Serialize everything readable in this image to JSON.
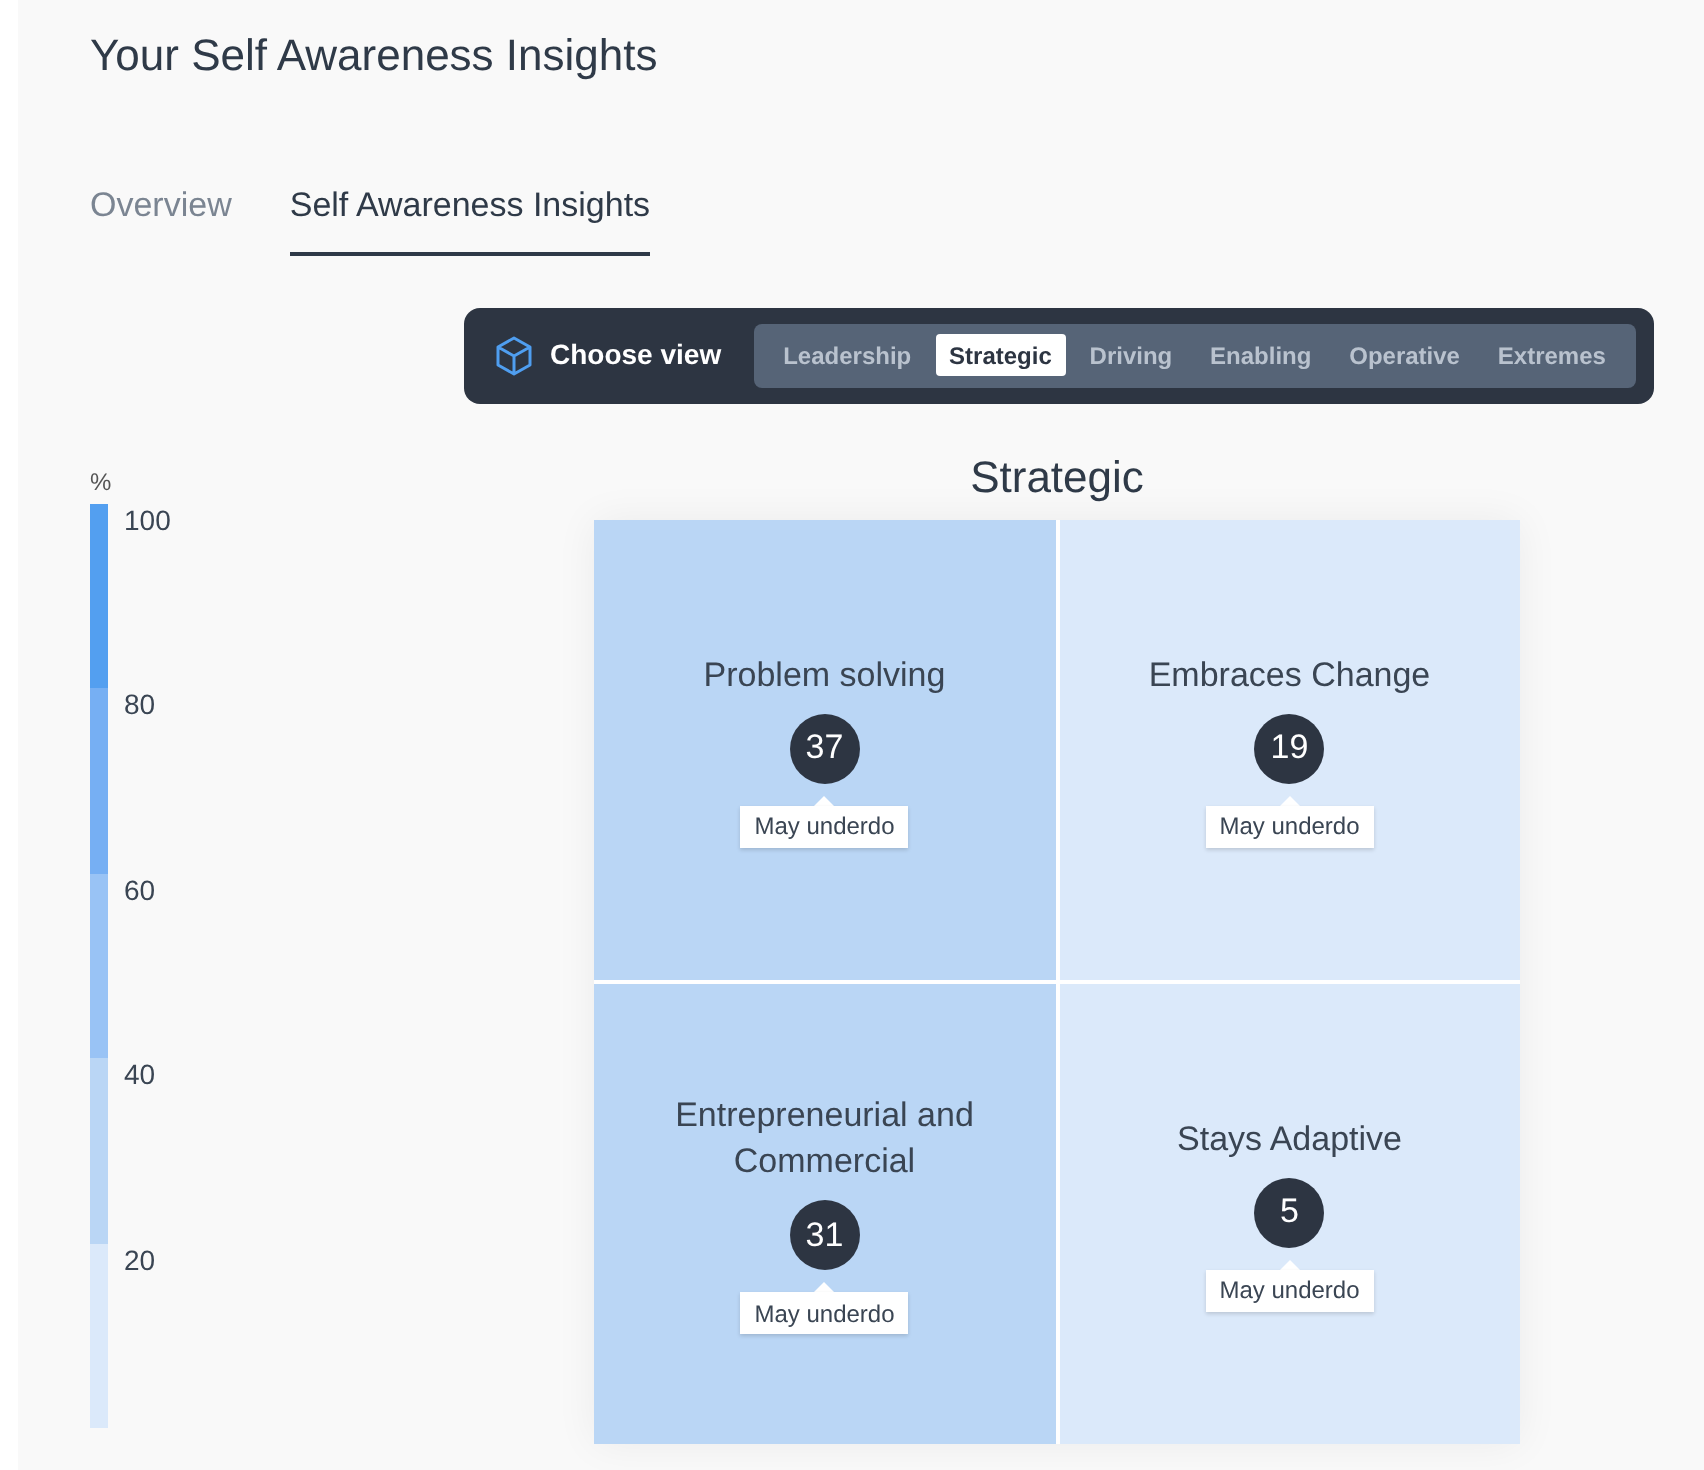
{
  "page": {
    "title": "Your Self Awareness Insights"
  },
  "tabs": [
    {
      "label": "Overview",
      "selected": false
    },
    {
      "label": "Self Awareness Insights",
      "selected": true
    }
  ],
  "view_picker": {
    "label": "Choose view",
    "options": [
      {
        "label": "Leadership",
        "selected": false
      },
      {
        "label": "Strategic",
        "selected": true
      },
      {
        "label": "Driving",
        "selected": false
      },
      {
        "label": "Enabling",
        "selected": false
      },
      {
        "label": "Operative",
        "selected": false
      },
      {
        "label": "Extremes",
        "selected": false
      }
    ]
  },
  "legend": {
    "unit": "%",
    "bands": [
      {
        "label": "100",
        "color": "#539ff0"
      },
      {
        "label": "80",
        "color": "#76aff3"
      },
      {
        "label": "60",
        "color": "#99c3f5"
      },
      {
        "label": "40",
        "color": "#bad6f5"
      },
      {
        "label": "20",
        "color": "#dbe9fa"
      }
    ]
  },
  "matrix": {
    "title": "Strategic",
    "cells": [
      {
        "name": "Problem solving",
        "score": "37",
        "tag": "May underdo",
        "color": "#bad6f5"
      },
      {
        "name": "Embraces Change",
        "score": "19",
        "tag": "May underdo",
        "color": "#dbe9fa"
      },
      {
        "name": "Entrepreneurial and Commercial",
        "score": "31",
        "tag": "May underdo",
        "color": "#bad6f5"
      },
      {
        "name": "Stays Adaptive",
        "score": "5",
        "tag": "May underdo",
        "color": "#dbe9fa"
      }
    ]
  }
}
